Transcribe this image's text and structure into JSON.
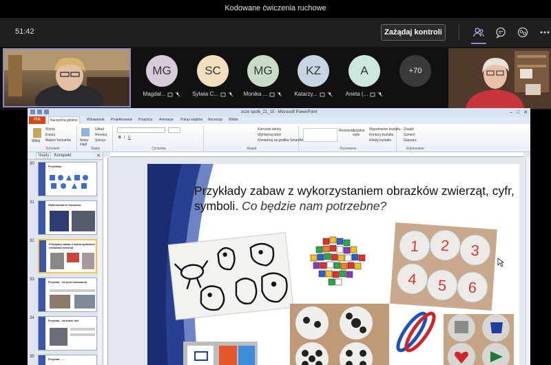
{
  "window": {
    "title": "Kodowane ćwiczenia ruchowe"
  },
  "meeting": {
    "timer": "51:42",
    "request_control_label": "Zażądaj kontroli",
    "icons": [
      "people-icon",
      "chat-icon",
      "rooms-icon",
      "more-icon"
    ]
  },
  "participants": [
    {
      "initials": "MG",
      "name": "Magdal...",
      "color": "#d7cbd9"
    },
    {
      "initials": "SC",
      "name": "Sylwia C...",
      "color": "#f3dfbd"
    },
    {
      "initials": "MG",
      "name": "Monika ...",
      "color": "#c9dcc7"
    },
    {
      "initials": "KZ",
      "name": "Katarzy...",
      "color": "#c5d6e2"
    },
    {
      "initials": "A",
      "name": "Aneta (...",
      "color": "#cce6e0"
    },
    {
      "initials": "+70",
      "name": "",
      "color": "#3a3a3a"
    }
  ],
  "ppt": {
    "title": "ocze spotk_21_10 - Microsoft PowerPoint",
    "file_tab": "Plik",
    "tabs": [
      "Narzędzia główne",
      "Wstawianie",
      "Projektowanie",
      "Przejścia",
      "Animacje",
      "Pokaz slajdów",
      "Recenzja",
      "Widok"
    ],
    "ribbon": {
      "paste": "Wklej",
      "cut": "Wytnij",
      "copy": "Kopiuj",
      "format_painter": "Malarz formatów",
      "new_slide": "Nowy slajd",
      "layout": "Układ",
      "reset": "Resetuj",
      "section": "Sekcja",
      "direction": "Kierunek tekstu",
      "align": "Wyrównaj tekst",
      "smartart": "Konwertuj na grafikę SmartArt",
      "arrange": "Rozmieść",
      "quick_styles": "Szybkie style",
      "shape_fill": "Wypełnienie kształtu",
      "shape_outline": "Kontury kształtu",
      "shape_effects": "Efekty kształtu",
      "find": "Znajdź",
      "replace": "Zamień",
      "select": "Zaznacz",
      "groups": [
        "Schowek",
        "Slajdy",
        "Czcionka",
        "Akapit",
        "Rysowanie",
        "Edytowanie"
      ]
    },
    "pane_tabs": [
      "Slajdy",
      "Konspekt"
    ],
    "thumbnails": [
      {
        "num": "30",
        "title": "Przykłady...",
        "selected": false
      },
      {
        "num": "31",
        "title": "Wykorzystanie obrazków",
        "selected": false
      },
      {
        "num": "32",
        "title": "Przykłady zabaw z wykorzystaniem obrazków zwierząt",
        "selected": true
      },
      {
        "num": "33",
        "title": "Przykład - na polu kodowania",
        "selected": false
      },
      {
        "num": "34",
        "title": "Przykład - na trasie linii",
        "selected": false
      },
      {
        "num": "35",
        "title": "Przykład - ...",
        "selected": false
      }
    ],
    "slide": {
      "title_main": "Przykłady zabaw z wykorzystaniem obrazków zwierząt, cyfr, symboli.",
      "title_sub": " Co  będzie nam potrzebne?",
      "numbers": [
        "1",
        "2",
        "3",
        "4",
        "5",
        "6"
      ]
    }
  }
}
